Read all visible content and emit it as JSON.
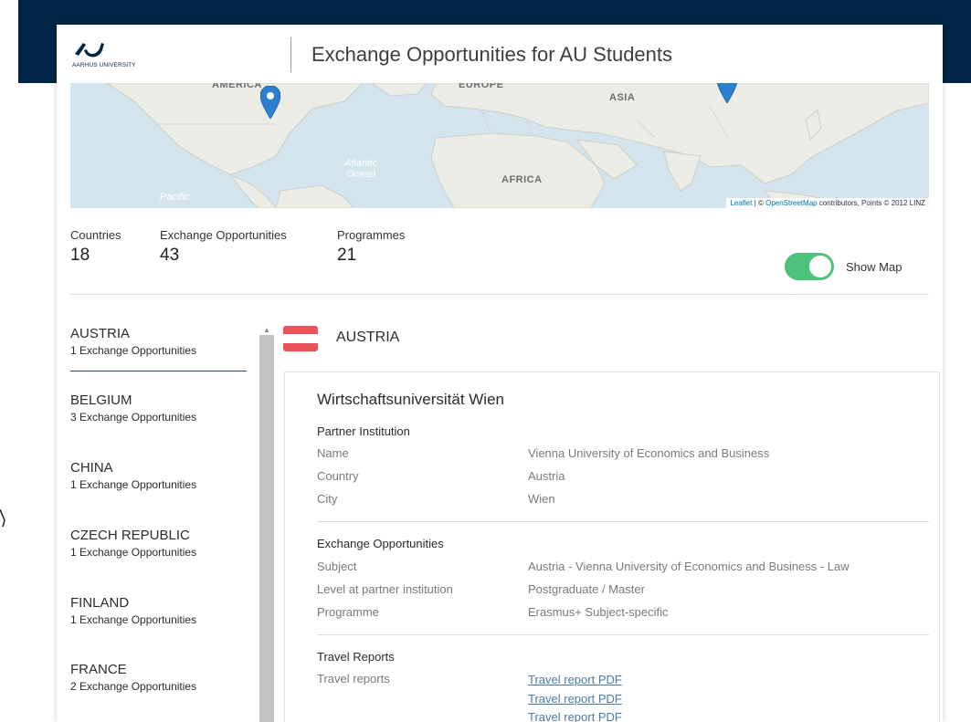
{
  "header": {
    "logo_text": "AARHUS UNIVERSITY",
    "title": "Exchange Opportunities for AU Students"
  },
  "map": {
    "labels": {
      "america": "AMERICA",
      "europe": "EUROPE",
      "asia": "ASIA",
      "africa": "AFRICA",
      "atlantic": "Atlantic",
      "ocean": "Ocean",
      "pacific": "Pacific"
    },
    "attribution": {
      "leaflet": "Leaflet",
      "sep1": " | © ",
      "osm": "OpenStreetMap",
      "rest": " contributors, Points © 2012 LINZ"
    },
    "colors": {
      "water": "#d4e4ec",
      "land": "#ecece6",
      "marker": "#2a7fd0"
    }
  },
  "stats": {
    "countries": {
      "label": "Countries",
      "value": "18"
    },
    "exchange": {
      "label": "Exchange Opportunities",
      "value": "43"
    },
    "programmes": {
      "label": "Programmes",
      "value": "21"
    }
  },
  "toggle": {
    "label": "Show Map",
    "on": true,
    "color": "#4cc27a"
  },
  "countries": [
    {
      "name": "AUSTRIA",
      "count": "1 Exchange Opportunities"
    },
    {
      "name": "BELGIUM",
      "count": "3 Exchange Opportunities"
    },
    {
      "name": "CHINA",
      "count": "1 Exchange Opportunities"
    },
    {
      "name": "CZECH REPUBLIC",
      "count": "1 Exchange Opportunities"
    },
    {
      "name": "FINLAND",
      "count": "1 Exchange Opportunities"
    },
    {
      "name": "FRANCE",
      "count": "2 Exchange Opportunities"
    }
  ],
  "detail": {
    "country": "AUSTRIA",
    "flag_colors": {
      "red": "#ea5358",
      "white": "#ffffff"
    },
    "university": "Wirtschaftsuniversität Wien",
    "partner": {
      "title": "Partner Institution",
      "rows": [
        {
          "label": "Name",
          "value": "Vienna University of Economics and Business"
        },
        {
          "label": "Country",
          "value": "Austria"
        },
        {
          "label": "City",
          "value": "Wien"
        }
      ]
    },
    "exchange": {
      "title": "Exchange Opportunities",
      "rows": [
        {
          "label": "Subject",
          "value": "Austria - Vienna University of Economics and Business - Law"
        },
        {
          "label": "Level at partner institution",
          "value": "Postgraduate / Master"
        },
        {
          "label": "Programme",
          "value": "Erasmus+ Subject-specific"
        }
      ]
    },
    "travel": {
      "title": "Travel Reports",
      "label": "Travel reports",
      "links": [
        "Travel report PDF",
        "Travel report PDF",
        "Travel report PDF"
      ]
    }
  },
  "colors": {
    "brand_dark": "#002546",
    "active_underline": "#2a4b6e",
    "link": "#4a7ba6"
  }
}
